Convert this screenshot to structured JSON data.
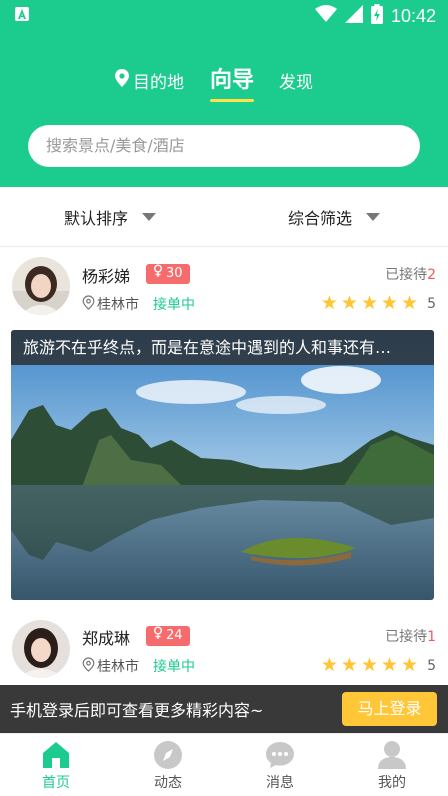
{
  "statusbar": {
    "time": "10:42"
  },
  "tabs": [
    {
      "label": "目的地"
    },
    {
      "label": "向导"
    },
    {
      "label": "发现"
    }
  ],
  "search": {
    "placeholder": "搜索景点/美食/酒店"
  },
  "filters": {
    "sort_label": "默认排序",
    "filter_label": "综合筛选"
  },
  "guides": [
    {
      "name": "杨彩娣",
      "badge_count": "30",
      "city": "桂林市",
      "status": "接单中",
      "served_label": "已接待",
      "served_count": "2",
      "rating": "5",
      "caption": "旅游不在乎终点，而是在意途中遇到的人和事还有…"
    },
    {
      "name": "郑成琳",
      "badge_count": "24",
      "city": "桂林市",
      "status": "接单中",
      "served_label": "已接待",
      "served_count": "1",
      "rating": "5"
    }
  ],
  "login_prompt": {
    "text": "手机登录后即可查看更多精彩内容~",
    "button": "马上登录"
  },
  "bottom_nav": [
    {
      "label": "首页",
      "icon": "home-icon"
    },
    {
      "label": "动态",
      "icon": "compass-icon"
    },
    {
      "label": "消息",
      "icon": "chat-icon"
    },
    {
      "label": "我的",
      "icon": "user-icon"
    }
  ],
  "colors": {
    "primary": "#1ccc8f",
    "accent_underline": "#ffe14a",
    "badge": "#f66b6b",
    "star": "#ffc533",
    "login_button": "#ffc637"
  }
}
